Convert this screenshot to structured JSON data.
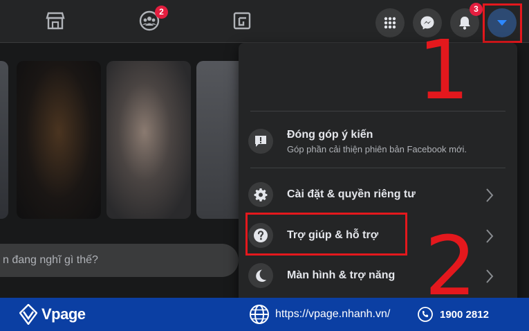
{
  "nav": {
    "groups_badge": "2",
    "notifications_badge": "3"
  },
  "menu": {
    "feedback": {
      "title": "Đóng góp ý kiến",
      "subtitle": "Góp phần cải thiện phiên bản Facebook mới."
    },
    "items": [
      {
        "label": "Cài đặt & quyền riêng tư",
        "icon": "gear-icon"
      },
      {
        "label": "Trợ giúp & hỗ trợ",
        "icon": "question-icon"
      },
      {
        "label": "Màn hình & trợ năng",
        "icon": "moon-icon"
      }
    ]
  },
  "composer": {
    "placeholder": "n đang nghĩ gì thế?"
  },
  "annotations": {
    "step1": "1",
    "step2": "2",
    "highlight_color": "#e4181d"
  },
  "footer": {
    "brand": "Vpage",
    "url": "https://vpage.nhanh.vn/",
    "phone": "1900 2812",
    "background": "#0b3fa3"
  }
}
